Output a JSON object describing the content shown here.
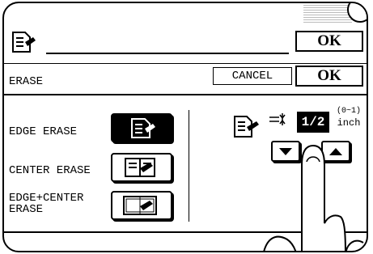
{
  "header": {
    "ok_label": "OK"
  },
  "erase_bar": {
    "title": "ERASE",
    "cancel_label": "CANCEL",
    "ok_label": "OK"
  },
  "modes": [
    {
      "label": "EDGE ERASE",
      "selected": true
    },
    {
      "label": "CENTER ERASE",
      "selected": false
    },
    {
      "label": "EDGE+CENTER\nERASE",
      "selected": false
    }
  ],
  "width_setting": {
    "value": "1/2",
    "range": "(0~1)",
    "unit": "inch"
  },
  "icons": [
    "document-icon",
    "erase-width-icon",
    "down-arrow-icon",
    "up-arrow-icon"
  ]
}
